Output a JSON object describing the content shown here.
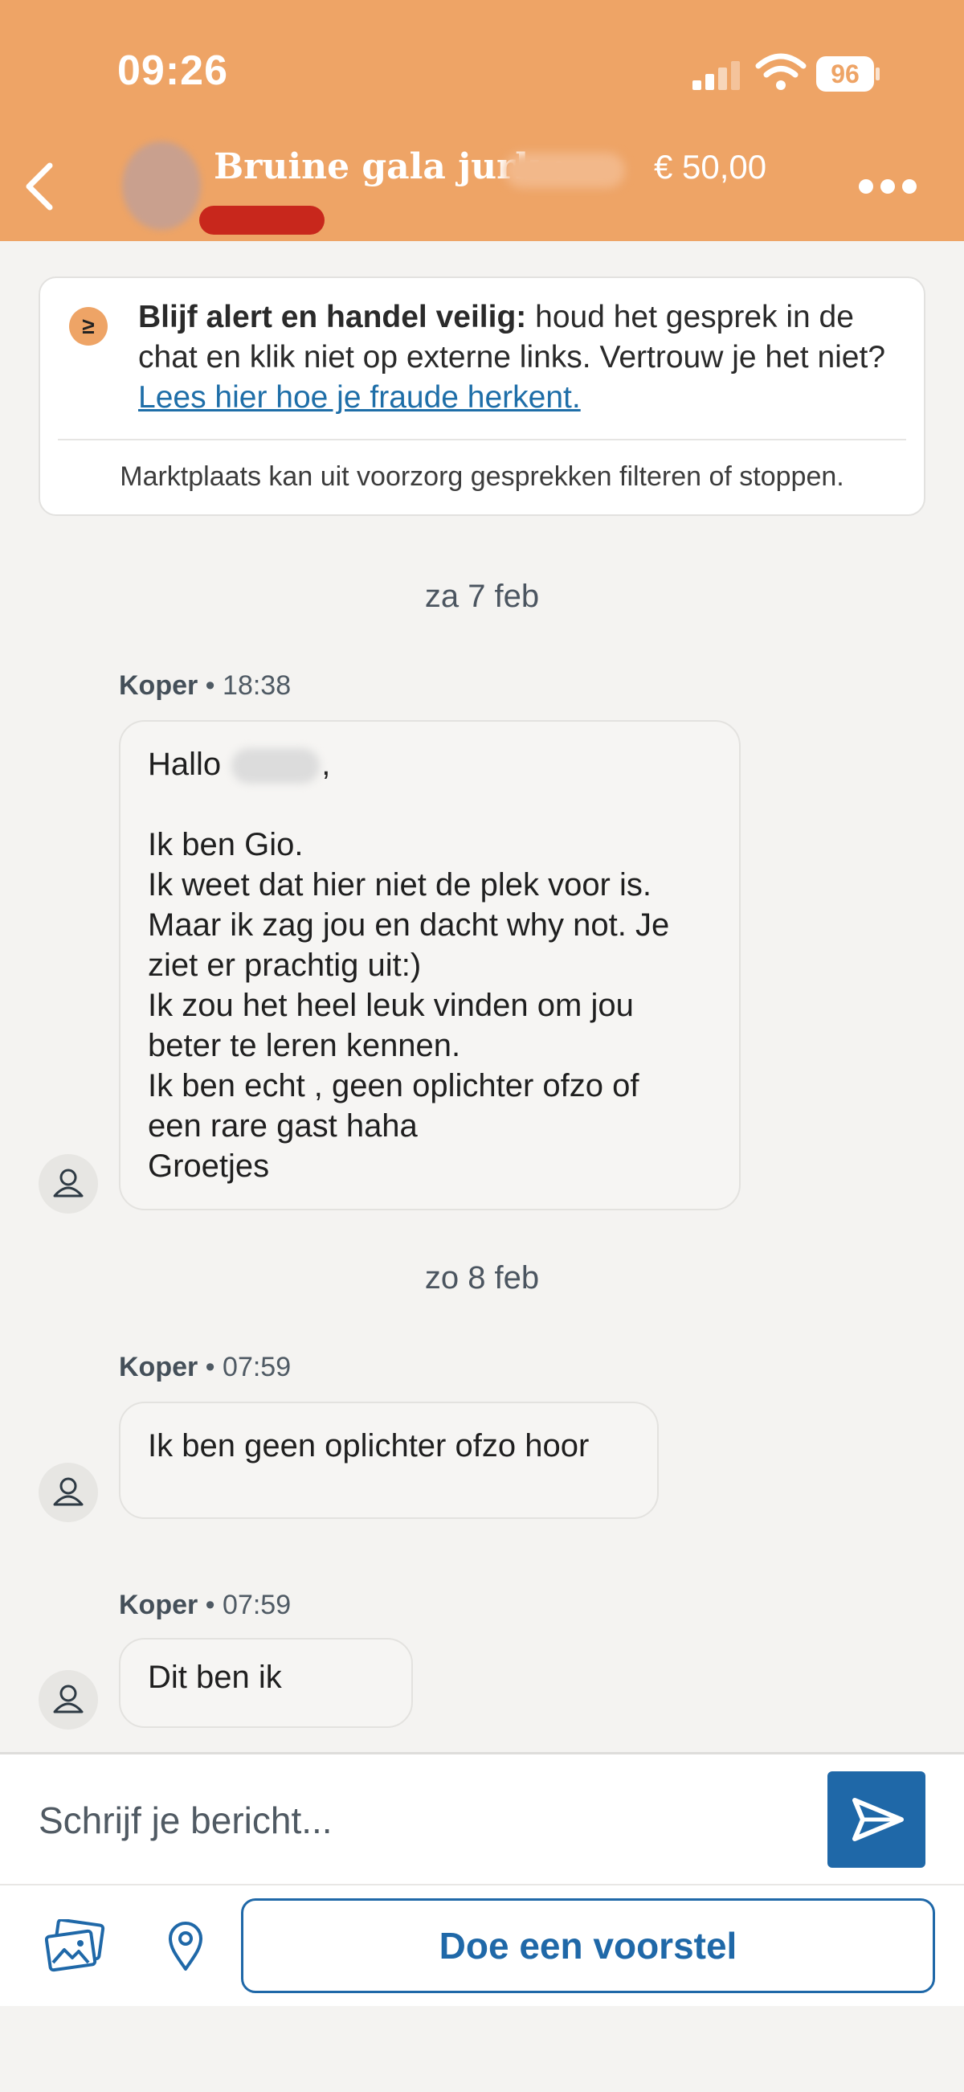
{
  "status_bar": {
    "time": "09:26",
    "battery": "96"
  },
  "header": {
    "title": "Bruine gala jurk :",
    "price": "€ 50,00"
  },
  "alert": {
    "icon": "≥",
    "bold": "Blijf alert en handel veilig:",
    "text": "houd het gesprek in de chat en klik niet op externe links. Vertrouw je het niet?",
    "link": "Lees hier hoe je fraude herkent.",
    "footer": "Marktplaats kan uit voorzorg gesprekken filteren of stoppen."
  },
  "conversation": {
    "date_1": "za 7 feb",
    "msg_1": {
      "sender": "Koper",
      "time": "18:38",
      "greeting_start": "Hallo",
      "greeting_end": ",",
      "lines": [
        "",
        "Ik ben Gio.",
        "Ik weet dat hier niet de plek voor is.",
        "Maar ik zag jou en dacht why not. Je",
        "ziet er prachtig uit:)",
        "Ik zou het heel leuk vinden om jou",
        "beter te leren kennen.",
        "Ik ben echt , geen oplichter ofzo of",
        "een rare gast haha",
        "Groetjes"
      ]
    },
    "date_2": "zo 8 feb",
    "msg_2": {
      "sender": "Koper",
      "time": "07:59",
      "text": "Ik ben geen oplichter ofzo hoor"
    },
    "msg_3": {
      "sender": "Koper",
      "time": "07:59",
      "text": "Dit ben ik"
    }
  },
  "composer": {
    "placeholder": "Schrijf je bericht...",
    "offer_button": "Doe een voorstel"
  },
  "colors": {
    "header": "#eea466",
    "accent": "#1f68a8",
    "link": "#1e6ea8"
  },
  "icons": [
    "back-icon",
    "more-icon",
    "signal-icon",
    "wifi-icon",
    "battery-icon",
    "user-icon",
    "send-icon",
    "image-icon",
    "location-icon"
  ]
}
